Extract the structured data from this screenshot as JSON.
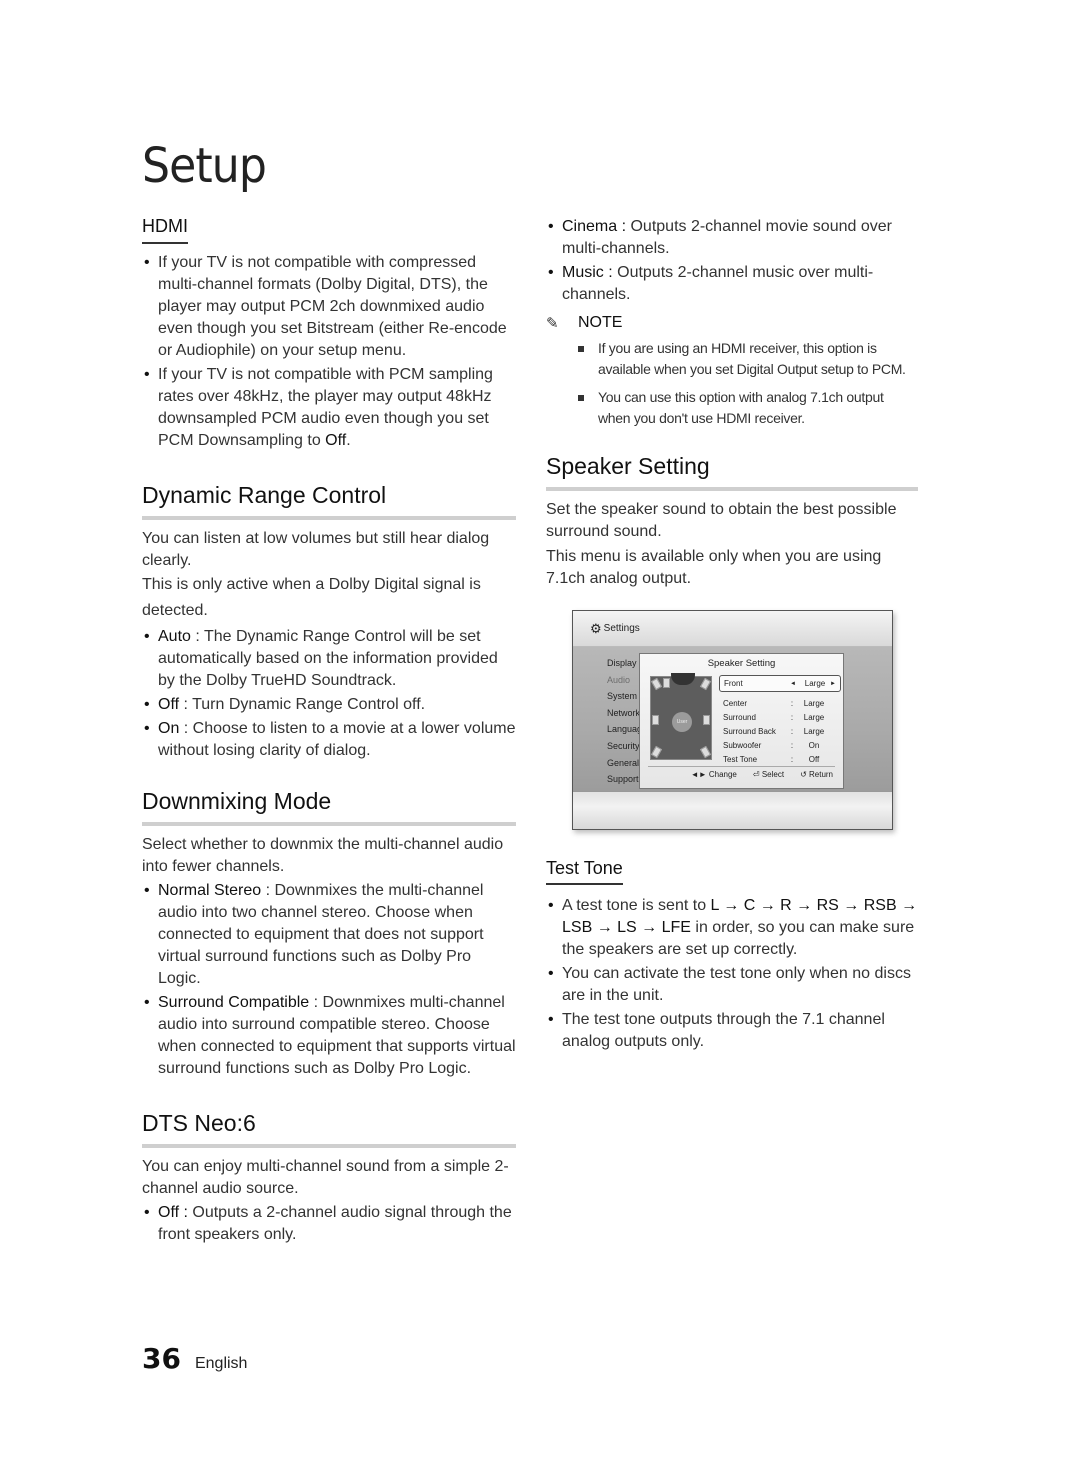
{
  "page": {
    "title": "Setup",
    "page_number": "36",
    "language": "English"
  },
  "hdmi": {
    "heading": "HDMI",
    "bullets": [
      "If your TV is not compatible with compressed multi-channel formats (Dolby Digital, DTS), the player may output PCM 2ch downmixed audio even though you set Bitstream (either Re-encode or Audiophile) on your setup menu.",
      {
        "pre": "If your TV is not compatible with PCM sampling rates over 48kHz, the player may output 48kHz downsampled PCM audio even though you set PCM Downsampling to ",
        "bold": "Off",
        "post": "."
      }
    ]
  },
  "drc": {
    "heading": "Dynamic Range Control",
    "intro1": "You can listen at low volumes but still hear dialog clearly.",
    "intro2": "This is only active when a Dolby Digital signal is detected.",
    "options": [
      {
        "term": "Auto",
        "desc": " : The Dynamic Range Control will be set automatically based on the information provided by the Dolby TrueHD Soundtrack."
      },
      {
        "term": "Off",
        "desc": " : Turn Dynamic Range Control off."
      },
      {
        "term": "On",
        "desc": " : Choose to listen to a movie at a lower volume without losing clarity of dialog."
      }
    ]
  },
  "downmix": {
    "heading": "Downmixing Mode",
    "intro": "Select whether to downmix the multi-channel audio into fewer channels.",
    "options": [
      {
        "term": "Normal Stereo",
        "desc": " : Downmixes the multi-channel audio into two channel stereo. Choose when connected to equipment that does not support virtual surround functions such as Dolby Pro Logic."
      },
      {
        "term": "Surround Compatible",
        "desc": " : Downmixes multi-channel audio into surround compatible stereo. Choose when connected to equipment that supports virtual surround functions such as Dolby Pro Logic."
      }
    ]
  },
  "dts": {
    "heading": "DTS Neo:6",
    "intro": "You can enjoy multi-channel sound from a simple 2-channel audio source.",
    "options": [
      {
        "term": "Off :",
        "desc": " Outputs a 2-channel audio signal through the front speakers only."
      },
      {
        "term": "Cinema :",
        "desc": " Outputs 2-channel movie sound over multi-channels."
      },
      {
        "term": "Music :",
        "desc": " Outputs 2-channel music over multi-channels."
      }
    ]
  },
  "note": {
    "label": "NOTE",
    "items": [
      "If you are using an HDMI receiver, this option is available when you set Digital Output setup to PCM.",
      "You can use this option with analog 7.1ch output when you don't use HDMI receiver."
    ]
  },
  "speaker": {
    "heading": "Speaker Setting",
    "intro1": "Set the speaker sound to obtain the best possible surround sound.",
    "intro2": "This menu is available only when you are using 7.1ch analog output."
  },
  "osd": {
    "top_title": "Settings",
    "side_menu": [
      "Display",
      "Audio",
      "System",
      "Network",
      "Language",
      "Security",
      "General",
      "Support"
    ],
    "side_menu_active": "Audio",
    "dialog_title": "Speaker Setting",
    "user_label": "User",
    "options": [
      {
        "label": "Front",
        "sep": "◄",
        "value": "Large",
        "selected": true
      },
      {
        "label": "Center",
        "sep": ":",
        "value": "Large"
      },
      {
        "label": "Surround",
        "sep": ":",
        "value": "Large"
      },
      {
        "label": "Surround Back",
        "sep": ":",
        "value": "Large"
      },
      {
        "label": "Subwoofer",
        "sep": ":",
        "value": "On"
      },
      {
        "label": "Test Tone",
        "sep": ":",
        "value": "Off"
      }
    ],
    "footer": {
      "change": "◄► Change",
      "select": "⏎ Select",
      "return": "↺ Return"
    }
  },
  "test_tone": {
    "heading": "Test Tone",
    "sequence": [
      "L",
      "C",
      "R",
      "RS",
      "RSB",
      "LSB",
      "LS",
      "LFE"
    ],
    "bullet1_pre": "A test tone is sent to ",
    "bullet1_post": " in order, so you can make sure the speakers are set up correctly.",
    "bullet2": "You can activate the test tone only when no discs are in the unit.",
    "bullet3": "The test tone outputs through the 7.1 channel analog outputs only."
  },
  "icons": {
    "note": "pencil-icon",
    "gear": "gear-icon"
  }
}
